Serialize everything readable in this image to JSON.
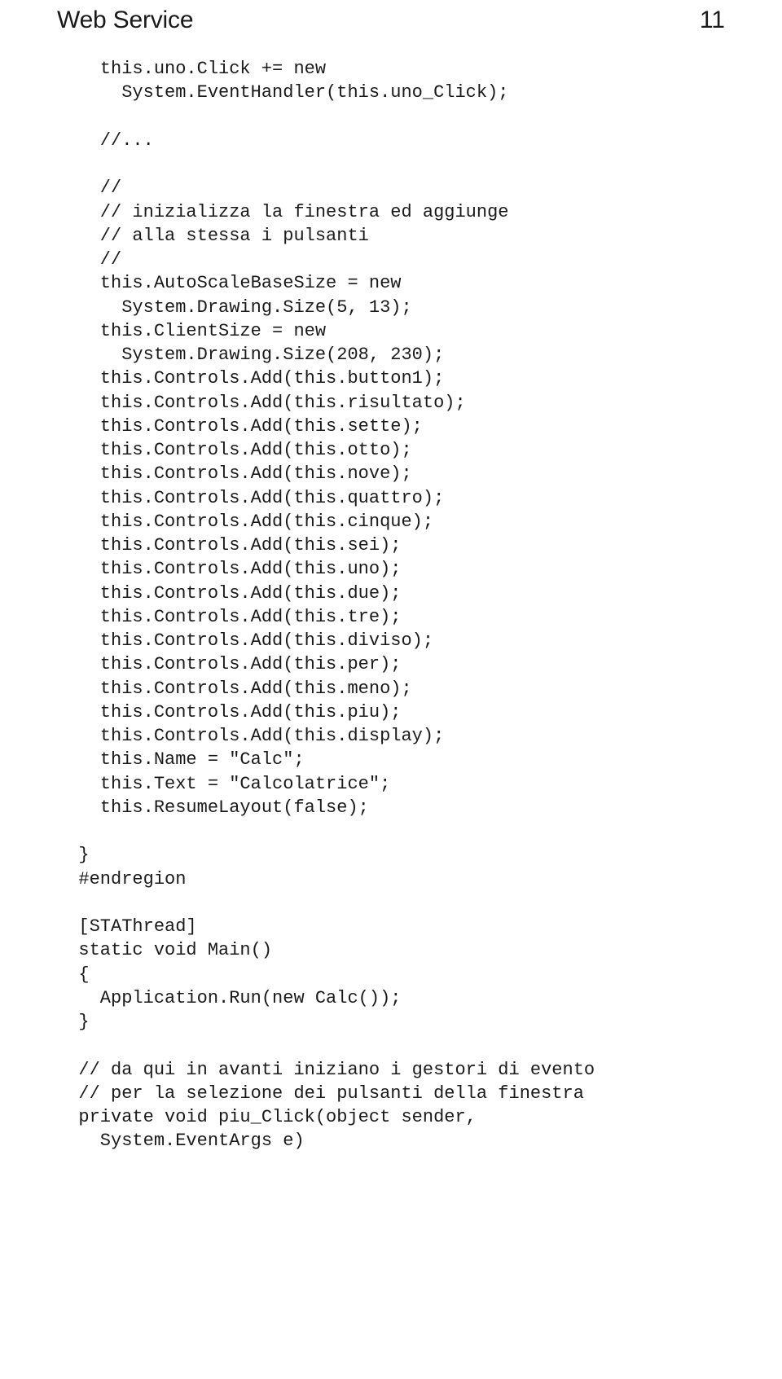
{
  "header": {
    "title": "Web Service",
    "page_number": "11"
  },
  "code": {
    "lines": [
      "    this.uno.Click += new",
      "      System.EventHandler(this.uno_Click);",
      "",
      "    //...",
      "",
      "    //",
      "    // inizializza la finestra ed aggiunge",
      "    // alla stessa i pulsanti",
      "    //",
      "    this.AutoScaleBaseSize = new",
      "      System.Drawing.Size(5, 13);",
      "    this.ClientSize = new",
      "      System.Drawing.Size(208, 230);",
      "    this.Controls.Add(this.button1);",
      "    this.Controls.Add(this.risultato);",
      "    this.Controls.Add(this.sette);",
      "    this.Controls.Add(this.otto);",
      "    this.Controls.Add(this.nove);",
      "    this.Controls.Add(this.quattro);",
      "    this.Controls.Add(this.cinque);",
      "    this.Controls.Add(this.sei);",
      "    this.Controls.Add(this.uno);",
      "    this.Controls.Add(this.due);",
      "    this.Controls.Add(this.tre);",
      "    this.Controls.Add(this.diviso);",
      "    this.Controls.Add(this.per);",
      "    this.Controls.Add(this.meno);",
      "    this.Controls.Add(this.piu);",
      "    this.Controls.Add(this.display);",
      "    this.Name = \"Calc\";",
      "    this.Text = \"Calcolatrice\";",
      "    this.ResumeLayout(false);",
      "",
      "  }",
      "  #endregion",
      "",
      "  [STAThread]",
      "  static void Main()",
      "  {",
      "    Application.Run(new Calc());",
      "  }",
      "",
      "  // da qui in avanti iniziano i gestori di evento",
      "  // per la selezione dei pulsanti della finestra",
      "  private void piu_Click(object sender,",
      "    System.EventArgs e)"
    ]
  }
}
